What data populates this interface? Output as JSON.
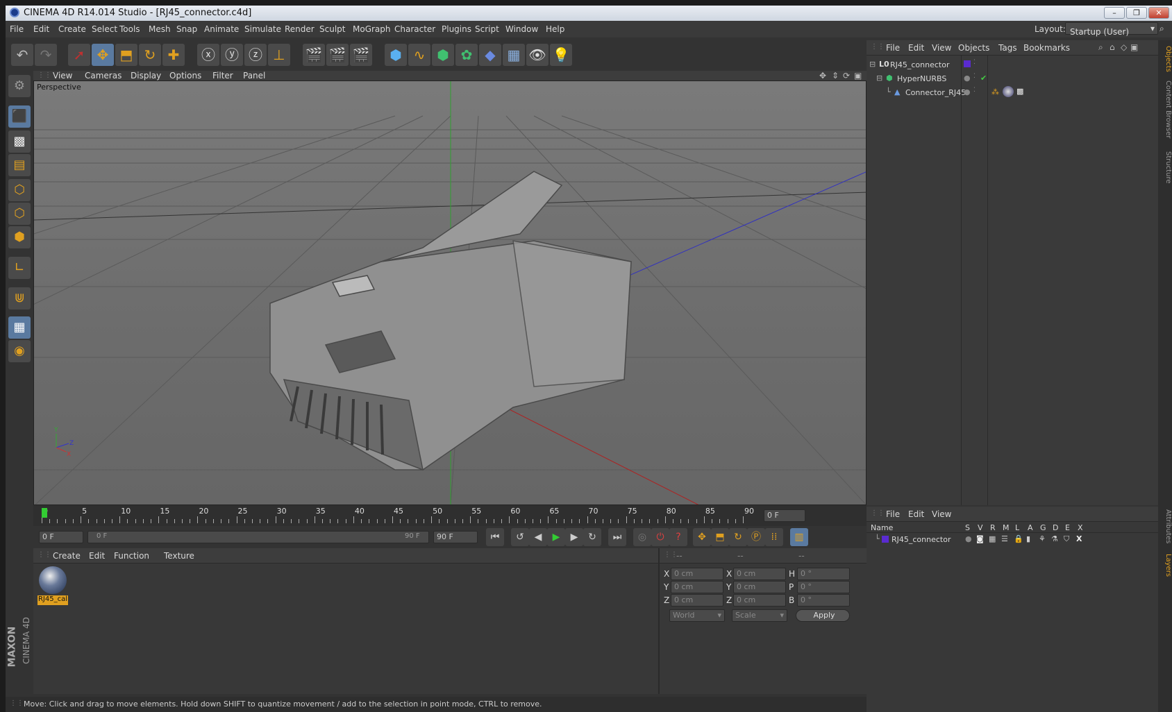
{
  "window": {
    "title": "CINEMA 4D R14.014 Studio - [RJ45_connector.c4d]"
  },
  "menu": [
    "File",
    "Edit",
    "Create",
    "Select",
    "Tools",
    "Mesh",
    "Snap",
    "Animate",
    "Simulate",
    "Render",
    "Sculpt",
    "MoGraph",
    "Character",
    "Plugins",
    "Script",
    "Window",
    "Help"
  ],
  "layout": {
    "label": "Layout:",
    "value": "Startup (User)"
  },
  "viewport": {
    "menu": [
      "View",
      "Cameras",
      "Display",
      "Options",
      "Filter",
      "Panel"
    ],
    "label": "Perspective"
  },
  "objects": {
    "menu": [
      "File",
      "Edit",
      "View",
      "Objects",
      "Tags",
      "Bookmarks"
    ],
    "items": [
      {
        "name": "RJ45_connector",
        "icon": "null-icon"
      },
      {
        "name": "HyperNURBS",
        "icon": "hypernurbs-icon"
      },
      {
        "name": "Connector_RJ45",
        "icon": "polygon-icon"
      }
    ]
  },
  "side_tabs": {
    "objects": "Objects",
    "content": "Content Browser",
    "structure": "Structure",
    "attributes": "Attributes",
    "layers": "Layers"
  },
  "timeline": {
    "ticks": [
      "0",
      "5",
      "10",
      "15",
      "20",
      "25",
      "30",
      "35",
      "40",
      "45",
      "50",
      "55",
      "60",
      "65",
      "70",
      "75",
      "80",
      "85",
      "90"
    ],
    "frame_display": "0 F",
    "start": "0 F",
    "range_start": "0 F",
    "range_end": "90 F",
    "end": "90 F"
  },
  "materials": {
    "menu": [
      "Create",
      "Edit",
      "Function",
      "Texture"
    ],
    "item": "RJ45_cal"
  },
  "coords": {
    "headers": [
      "--",
      "--",
      "--"
    ],
    "rows": [
      {
        "a": "X",
        "av": "0 cm",
        "b": "X",
        "bv": "0 cm",
        "c": "H",
        "cv": "0 °"
      },
      {
        "a": "Y",
        "av": "0 cm",
        "b": "Y",
        "bv": "0 cm",
        "c": "P",
        "cv": "0 °"
      },
      {
        "a": "Z",
        "av": "0 cm",
        "b": "Z",
        "bv": "0 cm",
        "c": "B",
        "cv": "0 °"
      }
    ],
    "mode": "World",
    "type": "Scale",
    "apply": "Apply"
  },
  "layers": {
    "menu": [
      "File",
      "Edit",
      "View"
    ],
    "columns": [
      "Name",
      "S",
      "V",
      "R",
      "M",
      "L",
      "A",
      "G",
      "D",
      "E",
      "X"
    ],
    "item": "RJ45_connector"
  },
  "status": "Move: Click and drag to move elements. Hold down SHIFT to quantize movement / add to the selection in point mode, CTRL to remove.",
  "brand": {
    "maxon": "MAXON",
    "product": "CINEMA 4D"
  },
  "colors": {
    "accent": "#e0a020",
    "selected": "#5a7aa0",
    "layer": "#5a2bd0"
  }
}
